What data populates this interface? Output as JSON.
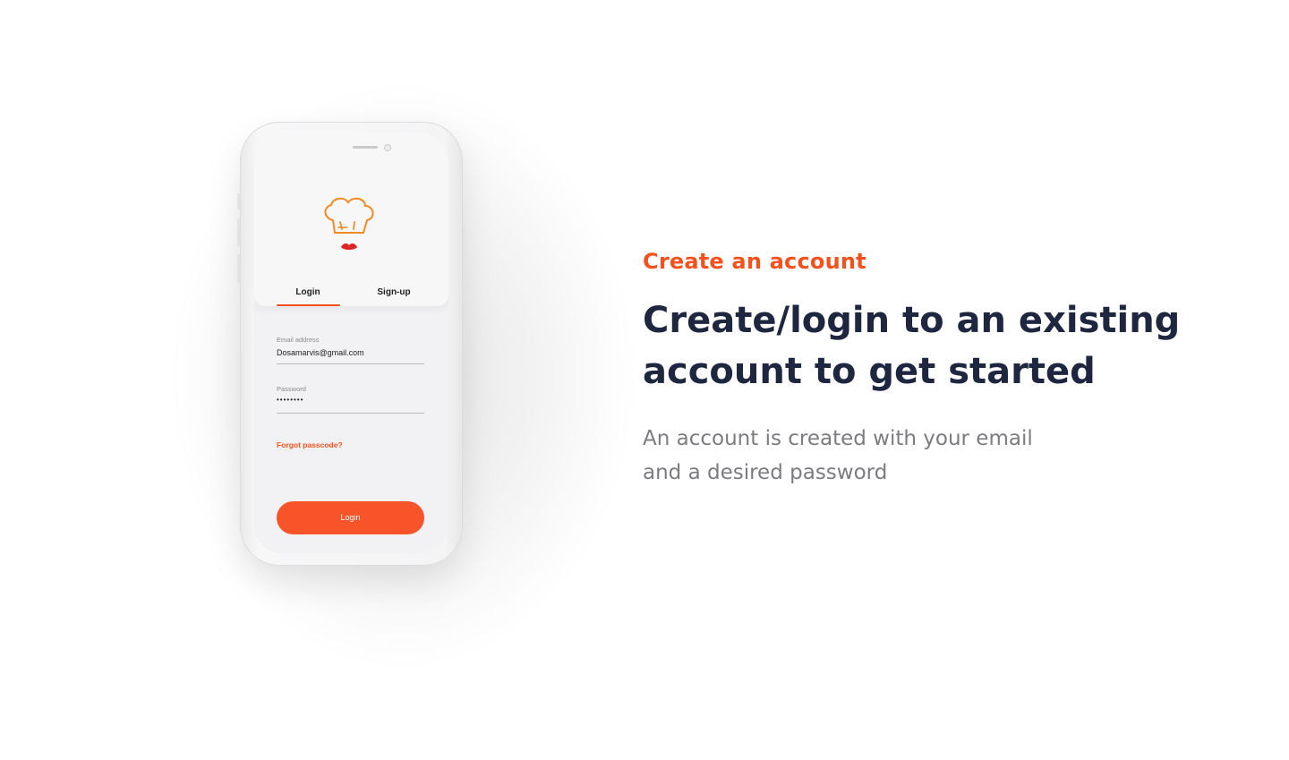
{
  "phone": {
    "tabs": [
      {
        "label": "Login",
        "active": true
      },
      {
        "label": "Sign-up",
        "active": false
      }
    ],
    "email": {
      "label": "Email address",
      "value": "Dosamarvis@gmail.com"
    },
    "password": {
      "label": "Password",
      "value": "••••••••"
    },
    "forgot_label": "Forgot passcode?",
    "login_button": "Login",
    "logo_icon": "chef-hat-icon",
    "accent_color": "#f4511e"
  },
  "content": {
    "eyebrow": "Create an account",
    "headline_line1": "Create/login to an existing",
    "headline_line2": "account to get started",
    "subtext_line1": "An account is created with your email",
    "subtext_line2": "and a desired password"
  },
  "colors": {
    "accent": "#f4511e",
    "headline": "#1f2640",
    "subtext": "#7b7b80"
  }
}
